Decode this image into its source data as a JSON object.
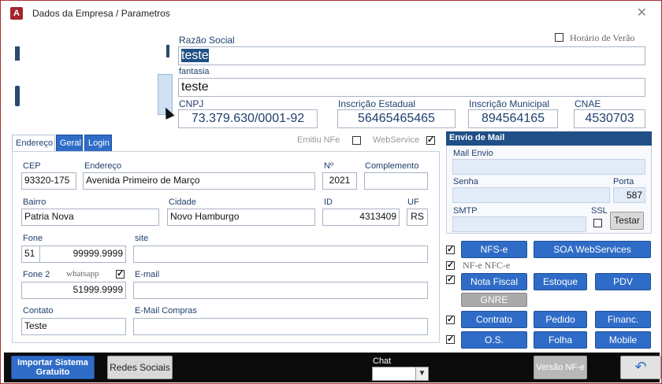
{
  "window": {
    "title": "Dados da Empresa / Parametros"
  },
  "header": {
    "razao_social_label": "Razão Social",
    "razao_social_value": "teste",
    "horario_verao_label": "Horário de Verão",
    "fantasia_label": "fantasia",
    "fantasia_value": "teste",
    "cnpj_label": "CNPJ",
    "cnpj_value": "73.379.630/0001-92",
    "ie_label": "Inscrição Estadual",
    "ie_value": "56465465465",
    "im_label": "Inscrição Municipal",
    "im_value": "894564165",
    "cnae_label": "CNAE",
    "cnae_value": "4530703"
  },
  "tabs": [
    {
      "label": "Endereço",
      "active": true
    },
    {
      "label": "Geral",
      "active": false
    },
    {
      "label": "Login",
      "active": false
    }
  ],
  "flags": {
    "emitiu_nfe_label": "Emitiu NFe",
    "webservice_label": "WebService"
  },
  "address": {
    "cep_label": "CEP",
    "cep": "93320-175",
    "endereco_label": "Endereço",
    "endereco": "Avenida Primeiro de Março",
    "numero_label": "Nº",
    "numero": "2021",
    "complemento_label": "Complemento",
    "complemento": "",
    "bairro_label": "Bairro",
    "bairro": "Patria Nova",
    "cidade_label": "Cidade",
    "cidade": "Novo Hamburgo",
    "id_label": "ID",
    "id": "4313409",
    "uf_label": "UF",
    "uf": "RS",
    "fone_label": "Fone",
    "fone_ddd": "51",
    "fone": "99999.9999",
    "site_label": "site",
    "site": "",
    "fone2_label": "Fone 2",
    "whatsapp_label": "whatsapp",
    "fone2": "51999.9999",
    "email_label": "E-mail",
    "email": "",
    "contato_label": "Contato",
    "contato": "Teste",
    "email_compras_label": "E-Mail Compras",
    "email_compras": ""
  },
  "mail": {
    "heading": "Envio de Mail",
    "mail_envio_label": "Mail Envio",
    "senha_label": "Senha",
    "porta_label": "Porta",
    "porta": "587",
    "smtp_label": "SMTP",
    "ssl_label": "SSL",
    "testar_label": "Testar"
  },
  "modules": {
    "nfse": "NFS-e",
    "soa": "SOA WebServices",
    "nfe_nfce_label": "NF-e NFC-e",
    "nota_fiscal": "Nota Fiscal",
    "estoque": "Estoque",
    "pdv": "PDV",
    "gnre": "GNRE",
    "contrato": "Contrato",
    "pedido": "Pedido",
    "financ": "Financ.",
    "os": "O.S.",
    "folha": "Folha",
    "mobile": "Mobile"
  },
  "footer": {
    "importar_label": "Importar Sistema Gratuito",
    "redes_label": "Redes Sociais",
    "chat_label": "Chat",
    "versao_label": "Versão NF-e",
    "back_icon": "undo-arrow-icon"
  },
  "colors": {
    "accent": "#2f6cc7",
    "header_blue": "#1f4f86",
    "window_border": "#b03030"
  }
}
